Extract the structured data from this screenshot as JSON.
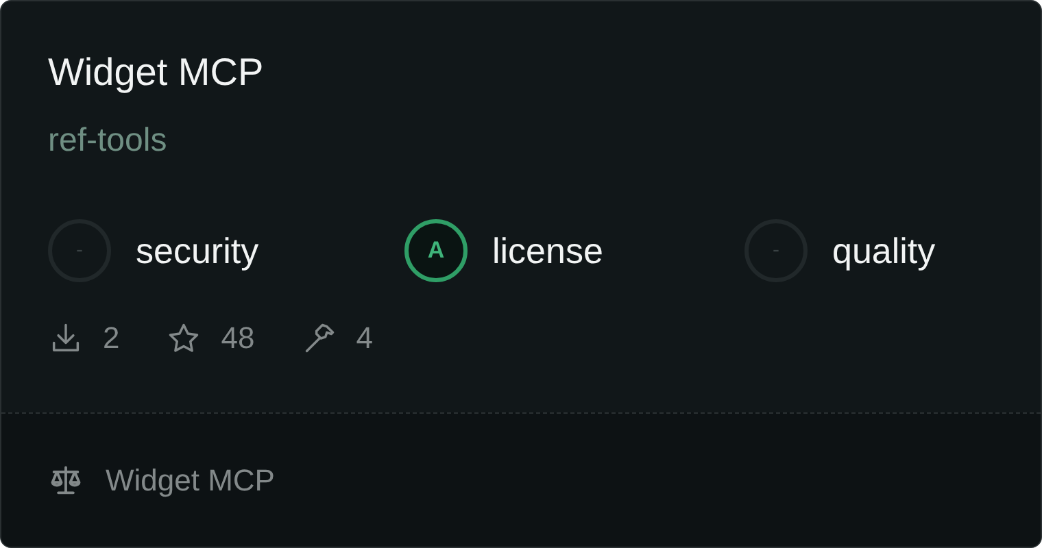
{
  "title": "Widget MCP",
  "subtitle": "ref-tools",
  "scores": [
    {
      "grade": "-",
      "label": "security",
      "graded": false
    },
    {
      "grade": "A",
      "label": "license",
      "graded": true
    },
    {
      "grade": "-",
      "label": "quality",
      "graded": false
    }
  ],
  "stats": [
    {
      "kind": "downloads",
      "value": "2"
    },
    {
      "kind": "stars",
      "value": "48"
    },
    {
      "kind": "tools",
      "value": "4"
    }
  ],
  "footer": {
    "kind": "license",
    "text": "Widget MCP"
  }
}
